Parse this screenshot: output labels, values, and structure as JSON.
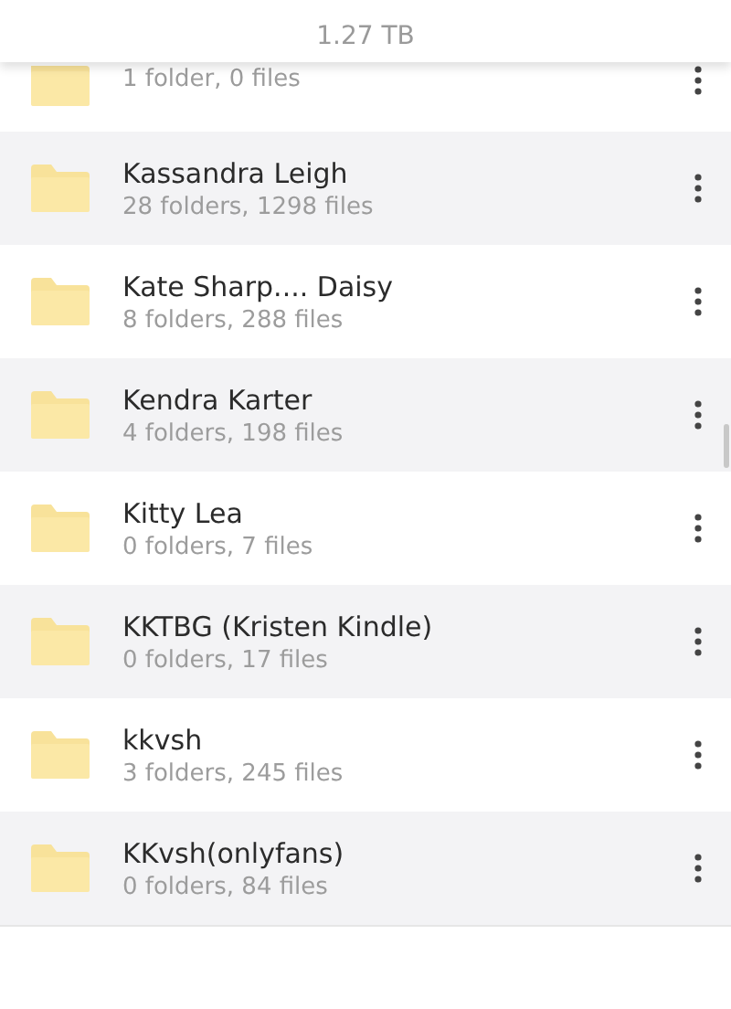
{
  "header": {
    "size": "1.27 TB"
  },
  "folders": [
    {
      "kind": "partial",
      "info": "1 folder, 0 files"
    },
    {
      "name": "Kassandra Leigh",
      "info": "28 folders, 1298 files"
    },
    {
      "name": "Kate Sharp.... Daisy",
      "info": "8 folders, 288 files"
    },
    {
      "name": "Kendra Karter",
      "info": "4 folders, 198 files"
    },
    {
      "name": "Kitty Lea",
      "info": "0 folders, 7 files"
    },
    {
      "name": "KKTBG (Kristen Kindle)",
      "info": "0 folders, 17 files"
    },
    {
      "name": "kkvsh",
      "info": "3 folders, 245 files"
    },
    {
      "name": "KKvsh(onlyfans)",
      "info": "0 folders, 84 files"
    }
  ]
}
